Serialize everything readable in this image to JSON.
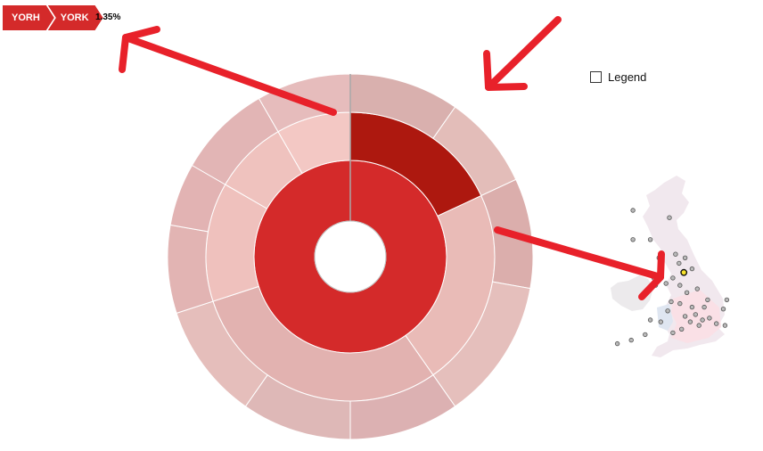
{
  "breadcrumb": {
    "items": [
      "YORH",
      "YORK"
    ]
  },
  "percentage": "1.35%",
  "legend": {
    "label": "Legend",
    "checked": false
  },
  "colors": {
    "accent": "#d42a2a",
    "highlight": "#b0180e",
    "annotation": "#e8212a"
  },
  "chart_data": {
    "type": "sunburst",
    "rings": [
      {
        "level": 1,
        "segments": [
          {
            "start": 0,
            "end": 360,
            "color": "#d42a2a"
          }
        ]
      },
      {
        "level": 2,
        "segments": [
          {
            "start": 0,
            "end": 65,
            "color": "#ad180f"
          },
          {
            "start": 65,
            "end": 145,
            "color": "#e9bbb7"
          },
          {
            "start": 145,
            "end": 252,
            "color": "#e2b2b0"
          },
          {
            "start": 252,
            "end": 300,
            "color": "#efc1bd"
          },
          {
            "start": 300,
            "end": 330,
            "color": "#efc2be"
          },
          {
            "start": 330,
            "end": 360,
            "color": "#f3c8c4"
          }
        ]
      },
      {
        "level": 3,
        "segments": [
          {
            "start": 0,
            "end": 35,
            "color": "#d9b0ae"
          },
          {
            "start": 35,
            "end": 65,
            "color": "#e3bdb9"
          },
          {
            "start": 65,
            "end": 100,
            "color": "#dbaeac"
          },
          {
            "start": 100,
            "end": 145,
            "color": "#e5bfbc"
          },
          {
            "start": 145,
            "end": 180,
            "color": "#dcb1b2"
          },
          {
            "start": 180,
            "end": 215,
            "color": "#deb8b7"
          },
          {
            "start": 215,
            "end": 252,
            "color": "#e5bebb"
          },
          {
            "start": 252,
            "end": 280,
            "color": "#e2b4b3"
          },
          {
            "start": 280,
            "end": 300,
            "color": "#e2b3b3"
          },
          {
            "start": 300,
            "end": 330,
            "color": "#e2b5b5"
          },
          {
            "start": 330,
            "end": 360,
            "color": "#e6bcbc"
          }
        ]
      }
    ],
    "map_sites": [
      {
        "lon": -1.27,
        "lat": 54.1,
        "highlight": true
      },
      {
        "lon": -1.55,
        "lat": 54.6,
        "highlight": false
      },
      {
        "lon": -1.2,
        "lat": 54.9,
        "highlight": false
      },
      {
        "lon": -1.75,
        "lat": 55.1,
        "highlight": false
      },
      {
        "lon": -0.8,
        "lat": 54.3,
        "highlight": false
      },
      {
        "lon": -2.3,
        "lat": 53.5,
        "highlight": false
      },
      {
        "lon": -1.9,
        "lat": 53.8,
        "highlight": false
      },
      {
        "lon": -1.5,
        "lat": 53.4,
        "highlight": false
      },
      {
        "lon": -1.1,
        "lat": 53.0,
        "highlight": false
      },
      {
        "lon": -0.5,
        "lat": 53.2,
        "highlight": false
      },
      {
        "lon": 0.1,
        "lat": 52.6,
        "highlight": false
      },
      {
        "lon": 1.2,
        "lat": 52.6,
        "highlight": false
      },
      {
        "lon": 1.0,
        "lat": 52.1,
        "highlight": false
      },
      {
        "lon": -2.0,
        "lat": 52.5,
        "highlight": false
      },
      {
        "lon": -1.5,
        "lat": 52.4,
        "highlight": false
      },
      {
        "lon": -0.8,
        "lat": 52.2,
        "highlight": false
      },
      {
        "lon": -0.1,
        "lat": 52.2,
        "highlight": false
      },
      {
        "lon": -0.2,
        "lat": 51.5,
        "highlight": false
      },
      {
        "lon": 0.2,
        "lat": 51.6,
        "highlight": false
      },
      {
        "lon": 0.6,
        "lat": 51.3,
        "highlight": false
      },
      {
        "lon": 1.1,
        "lat": 51.2,
        "highlight": false
      },
      {
        "lon": -0.4,
        "lat": 51.2,
        "highlight": false
      },
      {
        "lon": -0.9,
        "lat": 51.4,
        "highlight": false
      },
      {
        "lon": -1.4,
        "lat": 51.0,
        "highlight": false
      },
      {
        "lon": -1.9,
        "lat": 50.8,
        "highlight": false
      },
      {
        "lon": -2.6,
        "lat": 51.4,
        "highlight": false
      },
      {
        "lon": -3.2,
        "lat": 51.5,
        "highlight": false
      },
      {
        "lon": -3.5,
        "lat": 50.7,
        "highlight": false
      },
      {
        "lon": -4.3,
        "lat": 50.4,
        "highlight": false
      },
      {
        "lon": -5.1,
        "lat": 50.2,
        "highlight": false
      },
      {
        "lon": -2.9,
        "lat": 53.4,
        "highlight": false
      },
      {
        "lon": -3.0,
        "lat": 53.8,
        "highlight": false
      },
      {
        "lon": -2.7,
        "lat": 54.9,
        "highlight": false
      },
      {
        "lon": -3.2,
        "lat": 55.9,
        "highlight": false
      },
      {
        "lon": -4.2,
        "lat": 55.9,
        "highlight": false
      },
      {
        "lon": -2.1,
        "lat": 57.1,
        "highlight": false
      },
      {
        "lon": -4.2,
        "lat": 57.5,
        "highlight": false
      },
      {
        "lon": -2.2,
        "lat": 52.0,
        "highlight": false
      },
      {
        "lon": -1.2,
        "lat": 51.7,
        "highlight": false
      },
      {
        "lon": -0.6,
        "lat": 51.8,
        "highlight": false
      }
    ]
  }
}
